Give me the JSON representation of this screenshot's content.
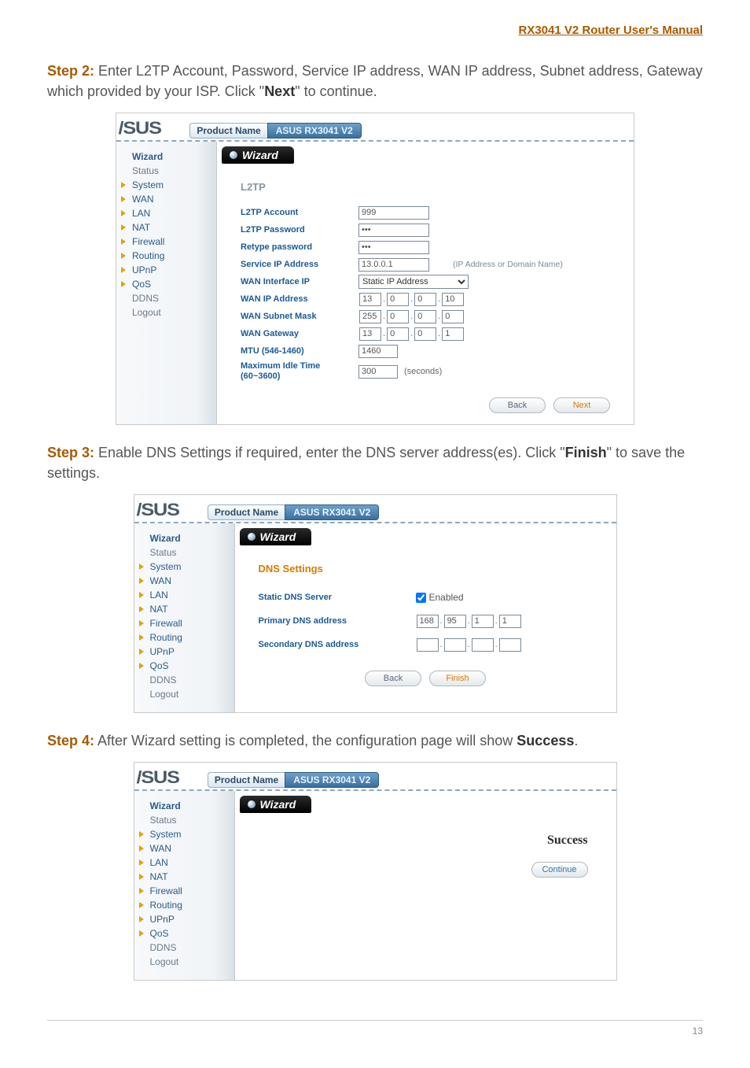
{
  "header_link": "RX3041 V2 Router User's Manual",
  "sidebar_items": [
    {
      "label": "Wizard",
      "cls": "top"
    },
    {
      "label": "Status",
      "cls": "plain"
    },
    {
      "label": "System",
      "cls": "exp"
    },
    {
      "label": "WAN",
      "cls": "exp"
    },
    {
      "label": "LAN",
      "cls": "exp"
    },
    {
      "label": "NAT",
      "cls": "exp"
    },
    {
      "label": "Firewall",
      "cls": "exp"
    },
    {
      "label": "Routing",
      "cls": "exp"
    },
    {
      "label": "UPnP",
      "cls": "exp"
    },
    {
      "label": "QoS",
      "cls": "exp"
    },
    {
      "label": "DDNS",
      "cls": "plain"
    },
    {
      "label": "Logout",
      "cls": "plain"
    }
  ],
  "product_name_label": "Product Name",
  "product_name_value": "ASUS RX3041 V2",
  "wizard_tab": "Wizard",
  "step2": {
    "prefix": "Step 2:",
    "text_a": " Enter L2TP Account, Password, Service IP address, WAN IP address, Subnet address, Gateway which provided by your ISP. Click \"",
    "bold": "Next",
    "text_b": "\" to continue.",
    "section": "L2TP",
    "rows": {
      "account_label": "L2TP Account",
      "account_value": "999",
      "password_label": "L2TP Password",
      "password_value": "•••",
      "retype_label": "Retype password",
      "retype_value": "•••",
      "service_ip_label": "Service IP Address",
      "service_ip_value": "13.0.0.1",
      "service_ip_note": "(IP Address or Domain Name)",
      "wan_if_label": "WAN Interface IP",
      "wan_if_value": "Static IP Address",
      "wan_ip_label": "WAN IP Address",
      "wan_ip": [
        "13",
        "0",
        "0",
        "10"
      ],
      "subnet_label": "WAN Subnet Mask",
      "subnet": [
        "255",
        "0",
        "0",
        "0"
      ],
      "gateway_label": "WAN Gateway",
      "gateway": [
        "13",
        "0",
        "0",
        "1"
      ],
      "mtu_label": "MTU (546-1460)",
      "mtu_value": "1460",
      "idle_label": "Maximum Idle Time (60~3600)",
      "idle_value": "300",
      "idle_unit": "(seconds)"
    },
    "btn_back": "Back",
    "btn_next": "Next"
  },
  "step3": {
    "prefix": "Step 3:",
    "text_a": " Enable DNS Settings if required, enter the DNS server address(es). Click \"",
    "bold": "Finish",
    "text_b": "\" to save the settings.",
    "section": "DNS Settings",
    "static_label": "Static DNS Server",
    "enabled_label": "Enabled",
    "primary_label": "Primary DNS address",
    "primary": [
      "168",
      "95",
      "1",
      "1"
    ],
    "secondary_label": "Secondary DNS address",
    "secondary": [
      "",
      "",
      "",
      ""
    ],
    "btn_back": "Back",
    "btn_finish": "Finish"
  },
  "step4": {
    "prefix": "Step 4:",
    "text_a": " After Wizard setting is completed, the configuration page will show ",
    "bold": "Success",
    "text_b": ".",
    "success": "Success",
    "btn_continue": "Continue"
  },
  "page_number": "13"
}
